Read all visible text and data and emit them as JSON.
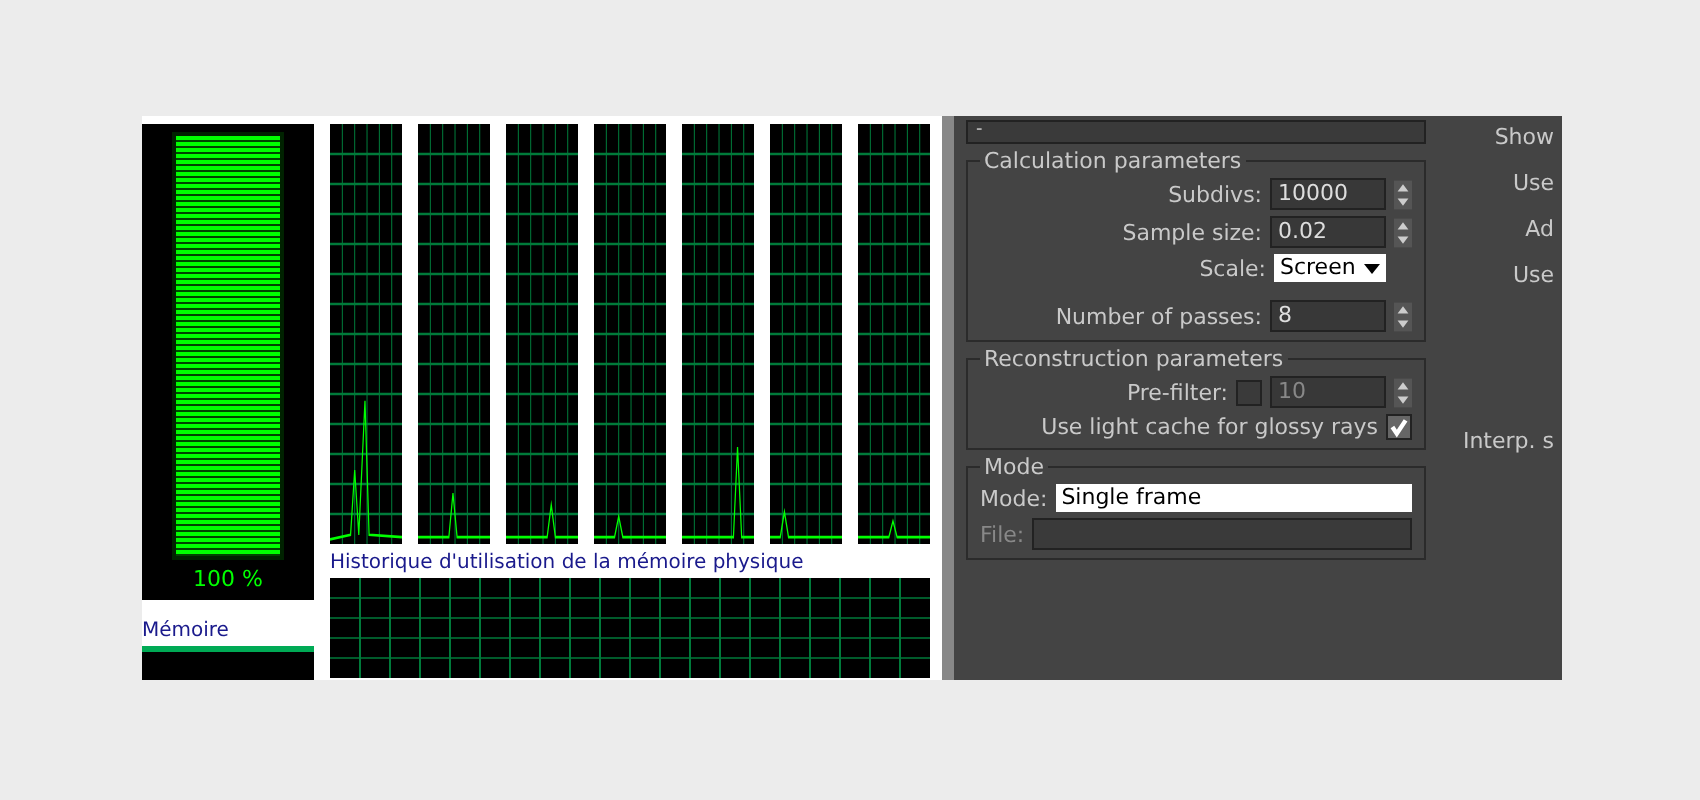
{
  "task_manager": {
    "cpu_meter": {
      "level": 1,
      "reading": "100 %"
    },
    "memory_label": "Mémoire",
    "memory_history_title": "Historique d'utilisation de la mémoire physique"
  },
  "render_settings": {
    "rollout_toggle": "-",
    "calculation": {
      "title": "Calculation parameters",
      "fields": [
        {
          "label": "Subdivs:",
          "value": "10000",
          "kind": "spinner"
        },
        {
          "label": "Sample size:",
          "value": "0.02",
          "kind": "spinner"
        },
        {
          "label": "Scale:",
          "value": "Screen",
          "kind": "dropdown"
        },
        {
          "label": "Number of passes:",
          "value": "8",
          "kind": "spinner"
        }
      ],
      "side_labels": [
        "Show",
        "Use",
        "Ad",
        "Use"
      ]
    },
    "reconstruction": {
      "title": "Reconstruction parameters",
      "prefilter": {
        "label": "Pre-filter:",
        "checked": false,
        "value": "10",
        "disabled": true
      },
      "glossy": {
        "label": "Use light cache for glossy rays",
        "checked": true
      },
      "side_label": "Interp. s"
    },
    "mode": {
      "title": "Mode",
      "mode_label": "Mode:",
      "mode_value": "Single frame",
      "file_label": "File:"
    }
  }
}
